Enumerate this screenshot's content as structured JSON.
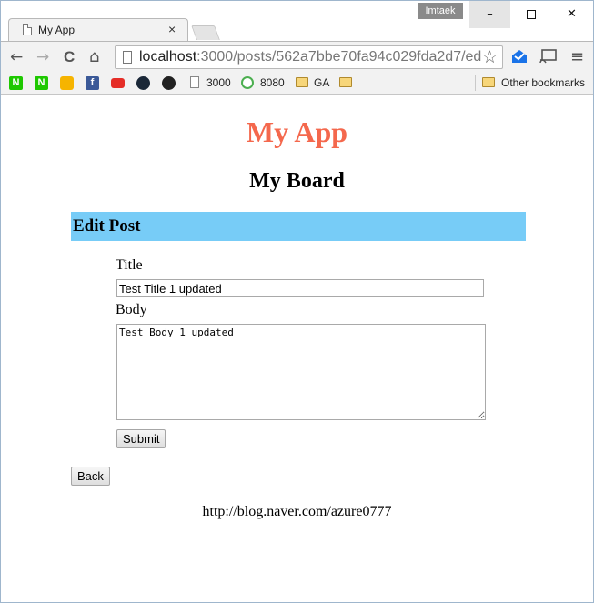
{
  "browser": {
    "tab_title": "My App",
    "tab_close": "×",
    "user_badge": "Imtaek",
    "window_controls": {
      "minimize": "–",
      "close": "✕"
    },
    "nav": {
      "back": "←",
      "forward": "→",
      "reload": "C",
      "home": "⌂"
    },
    "url_host": "localhost",
    "url_path": ":3000/posts/562a7bbe70fa94c029fda2d7/ed",
    "bookmark_star": "☆",
    "menu": "≡",
    "bookmarks": [
      {
        "label": "N",
        "icon": "naver-icon",
        "color": "#1ec800"
      },
      {
        "label": "N",
        "icon": "naver-icon",
        "color": "#1ec800"
      },
      {
        "label": "",
        "icon": "keep-icon",
        "color": "#f6b400"
      },
      {
        "label": "f",
        "icon": "facebook-icon",
        "color": "#3b5998"
      },
      {
        "label": "",
        "icon": "youtube-icon",
        "color": "#e52d27"
      },
      {
        "label": "",
        "icon": "app-icon",
        "color": "#1b2838"
      },
      {
        "label": "",
        "icon": "github-icon",
        "color": "#222222"
      },
      {
        "label": "3000",
        "icon": "page-icon"
      },
      {
        "label": "8080",
        "icon": "qr-icon"
      },
      {
        "label": "GA",
        "icon": "folder-icon"
      },
      {
        "label": "",
        "icon": "folder-icon"
      }
    ],
    "other_bookmarks": "Other bookmarks"
  },
  "page": {
    "app_title": "My App",
    "board_title": "My Board",
    "section_title": "Edit Post",
    "form": {
      "title_label": "Title",
      "title_value": "Test Title 1 updated",
      "body_label": "Body",
      "body_value": "Test Body 1 updated",
      "submit_label": "Submit"
    },
    "back_label": "Back",
    "footer_link": "http://blog.naver.com/azure0777"
  },
  "colors": {
    "app_title": "#f4684d",
    "section_bar": "#77ccf7"
  }
}
